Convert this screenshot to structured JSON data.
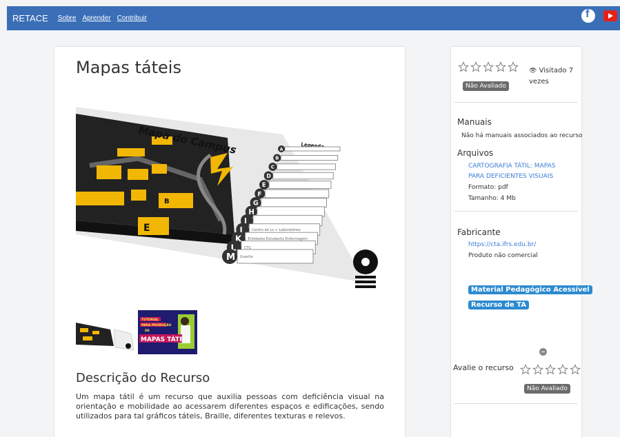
{
  "nav": {
    "brand": "RETACE",
    "links": [
      "Sobre",
      "Aprender",
      "Contribuir"
    ],
    "social": [
      "facebook-icon",
      "youtube-icon"
    ]
  },
  "resource": {
    "title": "Mapas táteis",
    "image_text": {
      "map_title": "Mapa do Campus",
      "legend": "Legenda",
      "letters": [
        "A",
        "B",
        "C",
        "D",
        "E",
        "F",
        "G",
        "H",
        "I",
        "J",
        "K",
        "L",
        "M"
      ],
      "row_labels": {
        "L": "CTG",
        "M": "Guarita",
        "K": "Entidades Estudantis Enfermagem",
        "J": "Centro de Lx + Laboratórios",
        "E": "E",
        "B": "B"
      }
    },
    "video_thumb_text": [
      "TUTORIAL",
      "PARA PRODUÇÃO",
      "DE",
      "MAPAS TÁTEIS"
    ],
    "description_heading": "Descrição do Recurso",
    "description": "Um mapa tátil é um recurso que auxilia pessoas com deficiência visual na orientação e mobilidade ao acessarem diferentes espaços e edificações, sendo utilizados para tal gráficos táteis, Braille, diferentes texturas e relevos."
  },
  "sidebar": {
    "visited": "Visitado 7 vezes",
    "rating_badge": "Não Avaliado",
    "manuais_heading": "Manuais",
    "manuais_text": "Não há manuais associados ao recurso",
    "arquivos_heading": "Arquivos",
    "arquivo_link": "CARTOGRAFIA TÁTIL: MAPAS PARA DEFICIENTES VISUAIS",
    "formato": "Formato: pdf",
    "tamanho": "Tamanho: 4 Mb",
    "fabricante_heading": "Fabricante",
    "fabricante_link": "https://cta.ifrs.edu.br/",
    "produto": "Produto não comercial",
    "tags": [
      "Material Pedagógico Acessível",
      "Recurso de TA"
    ],
    "avalie_label": "Avalie o recurso",
    "rating_badge_bottom": "Não Avaliado"
  },
  "colors": {
    "navbar": "#3a6fb8",
    "tag": "#2c8ad0",
    "link": "#3a7bd5",
    "badge": "#6b6b6b"
  }
}
